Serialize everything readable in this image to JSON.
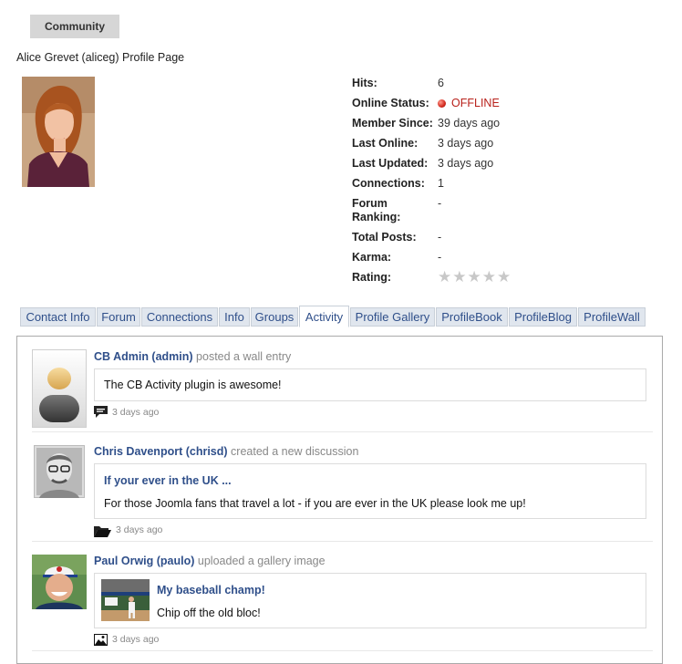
{
  "header": {
    "community_label": "Community"
  },
  "profile": {
    "title": "Alice Grevet (aliceg) Profile Page",
    "stats": [
      {
        "label": "Hits:",
        "value": "6"
      },
      {
        "label": "Online Status:",
        "value": "OFFLINE"
      },
      {
        "label": "Member Since:",
        "value": "39 days ago"
      },
      {
        "label": "Last Online:",
        "value": "3 days ago"
      },
      {
        "label": "Last Updated:",
        "value": "3 days ago"
      },
      {
        "label": "Connections:",
        "value": "1"
      },
      {
        "label": "Forum Ranking:",
        "value": "-"
      },
      {
        "label": "Total Posts:",
        "value": "-"
      },
      {
        "label": "Karma:",
        "value": "-"
      },
      {
        "label": "Rating:",
        "value": ""
      }
    ],
    "rating_stars": 0,
    "rating_max": 5
  },
  "tabs": [
    {
      "label": "Contact Info"
    },
    {
      "label": "Forum"
    },
    {
      "label": "Connections"
    },
    {
      "label": "Info"
    },
    {
      "label": "Groups"
    },
    {
      "label": "Activity",
      "active": true
    },
    {
      "label": "Profile Gallery"
    },
    {
      "label": "ProfileBook"
    },
    {
      "label": "ProfileBlog"
    },
    {
      "label": "ProfileWall"
    }
  ],
  "activity": [
    {
      "user": "CB Admin (admin)",
      "action": "posted a wall entry",
      "body": "The CB Activity plugin is awesome!",
      "time": "3 days ago",
      "icon": "comment-icon"
    },
    {
      "user": "Chris Davenport (chrisd)",
      "action": "created a new discussion",
      "title": "If your ever in the UK ...",
      "body": "For those Joomla fans that travel a lot - if you are ever in the UK please look me up!",
      "time": "3 days ago",
      "icon": "folder-icon"
    },
    {
      "user": "Paul Orwig (paulo)",
      "action": "uploaded a gallery image",
      "title": "My baseball champ!",
      "body": "Chip off the old bloc!",
      "time": "3 days ago",
      "icon": "image-icon"
    }
  ],
  "colors": {
    "link": "#2f4f8a",
    "offline": "#b8211b",
    "tab_bg": "#e0e6ee"
  }
}
